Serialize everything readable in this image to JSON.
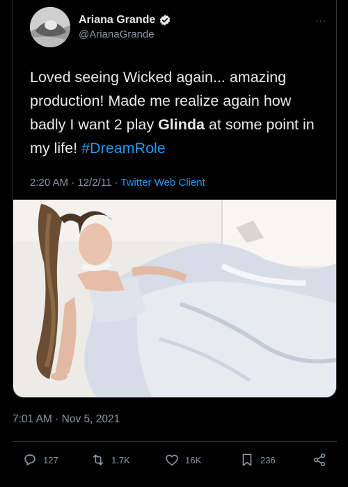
{
  "quoted_tweet": {
    "display_name": "Ariana Grande",
    "handle": "@ArianaGrande",
    "verified_icon": "verified-badge-icon",
    "more_icon": "more-options-icon",
    "more_label": "···",
    "text_before_bold": "Loved seeing Wicked again... amazing production! Made me realize again how badly I want 2 play ",
    "text_bold": "Glinda",
    "text_after_bold": " at some point in my life! ",
    "hashtag": "#DreamRole",
    "timestamp": "2:20 AM · 12/2/11 · ",
    "client": "Twitter Web Client"
  },
  "photo": {
    "icon": "photo-image"
  },
  "outer_tweet": {
    "timestamp": "7:01 AM · Nov 5, 2021"
  },
  "actions": {
    "reply_count": "127",
    "retweet_count": "1.7K",
    "like_count": "16K",
    "bookmark_count": "236"
  },
  "colors": {
    "background": "#000000",
    "text": "#e7e9ea",
    "secondary": "#8b98a5",
    "accent": "#1d9bf0",
    "border": "#2f3336"
  }
}
